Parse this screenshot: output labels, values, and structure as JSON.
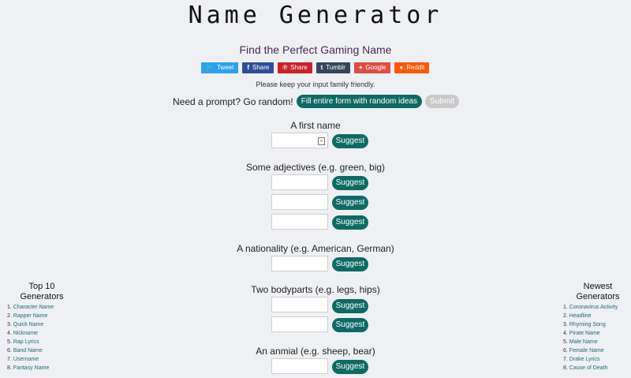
{
  "page": {
    "title": "Name Generator",
    "subtitle": "Find the Perfect Gaming Name",
    "notice": "Please keep your input family friendly.",
    "prompt_text": "Need a prompt? Go random!",
    "random_button": "Fill entire form with random ideas",
    "submit_button": "Submit"
  },
  "share": [
    {
      "label": "Tweet",
      "icon": "twitter-icon",
      "glyph": "🐦",
      "color": "#2aa3ef"
    },
    {
      "label": "Share",
      "icon": "facebook-icon",
      "glyph": "f",
      "color": "#2d4f9a"
    },
    {
      "label": "Share",
      "icon": "pinterest-icon",
      "glyph": "℗",
      "color": "#cc2127"
    },
    {
      "label": "Tumblr",
      "icon": "tumblr-icon",
      "glyph": "t",
      "color": "#35465c"
    },
    {
      "label": "Google",
      "icon": "google-icon",
      "glyph": "+",
      "color": "#dc4e41"
    },
    {
      "label": "Reddit",
      "icon": "reddit-icon",
      "glyph": "●",
      "color": "#ff5700"
    }
  ],
  "fields": {
    "first_name": {
      "label": "A first name"
    },
    "adjectives": {
      "label": "Some adjectives (e.g. green, big)"
    },
    "nationality": {
      "label": "A nationality (e.g. American, German)"
    },
    "bodyparts": {
      "label": "Two bodyparts (e.g. legs, hips)"
    },
    "animal": {
      "label": "An anmial (e.g. sheep, bear)"
    },
    "suggest_label": "Suggest"
  },
  "sidebar_left": {
    "title_line1": "Top 10",
    "title_line2": "Generators",
    "items": [
      {
        "num": "1.",
        "label": "Character Name"
      },
      {
        "num": "2.",
        "label": "Rapper Name"
      },
      {
        "num": "3.",
        "label": "Quick Name"
      },
      {
        "num": "4.",
        "label": "Nickname"
      },
      {
        "num": "5.",
        "label": "Rap Lyrics"
      },
      {
        "num": "6.",
        "label": "Band Name"
      },
      {
        "num": "7.",
        "label": "Username"
      },
      {
        "num": "8.",
        "label": "Fantasy Name"
      }
    ]
  },
  "sidebar_right": {
    "title_line1": "Newest",
    "title_line2": "Generators",
    "items": [
      {
        "num": "1.",
        "label": "Coronavirus Activity"
      },
      {
        "num": "2.",
        "label": "Headline"
      },
      {
        "num": "3.",
        "label": "Rhyming Song"
      },
      {
        "num": "4.",
        "label": "Pirate Name"
      },
      {
        "num": "5.",
        "label": "Male Name"
      },
      {
        "num": "6.",
        "label": "Female Name"
      },
      {
        "num": "7.",
        "label": "Drake Lyrics"
      },
      {
        "num": "8.",
        "label": "Cause of Death"
      }
    ]
  }
}
